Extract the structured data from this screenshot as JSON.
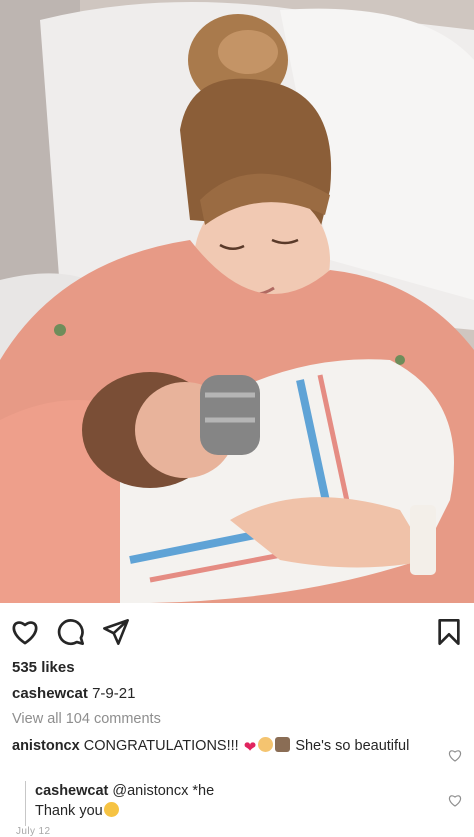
{
  "post": {
    "image_alt": "",
    "likes": "535 likes",
    "caption": {
      "username": "cashewcat",
      "text": "7-9-21"
    },
    "view_all_comments": "View all 104 comments",
    "comments": [
      {
        "username": "anistoncx",
        "text_before": "CONGRATULATIONS!!!",
        "text_after": "She's so beautiful",
        "emojis": [
          "red-heart",
          "baby-face",
          "person-feeding-baby"
        ],
        "replies": [
          {
            "username": "cashewcat",
            "mention": "@anistoncx",
            "text_line1": "*he",
            "text_line2": "Thank you",
            "emoji": "smiling-face-with-hearts"
          }
        ]
      }
    ],
    "date": "July 12"
  },
  "icons": {
    "like": "heart-icon",
    "comment": "comment-icon",
    "share": "paper-plane-icon",
    "save": "bookmark-icon"
  },
  "colors": {
    "text": "#262626",
    "muted": "#8e8e8e",
    "heart": "#e0245e"
  }
}
